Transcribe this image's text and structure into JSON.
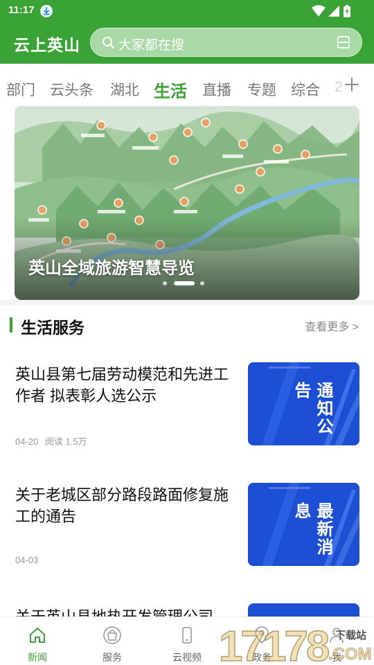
{
  "status_bar": {
    "time": "11:17"
  },
  "header": {
    "app_title": "云上英山",
    "search_placeholder": "大家都在搜"
  },
  "tabs": [
    {
      "label": "部门",
      "active": false
    },
    {
      "label": "云头条",
      "active": false
    },
    {
      "label": "湖北",
      "active": false
    },
    {
      "label": "生活",
      "active": true
    },
    {
      "label": "直播",
      "active": false
    },
    {
      "label": "专题",
      "active": false
    },
    {
      "label": "综合",
      "active": false
    },
    {
      "label": "2",
      "active": false
    }
  ],
  "banner": {
    "caption": "英山全域旅游智慧导览",
    "slide_count": 3,
    "active_slide": 2
  },
  "section": {
    "title": "生活服务",
    "more_label": "查看更多 >"
  },
  "news": [
    {
      "title": "英山县第七届劳动模范和先进工作者 拟表彰人选公示",
      "date": "04-20",
      "reads": "阅读 1.5万",
      "thumb_text": "通知公告"
    },
    {
      "title": "关于老城区部分路段路面修复施工的通告",
      "date": "04-03",
      "reads": "",
      "thumb_text": "最新消息"
    },
    {
      "title": "关于英山县地热开发管理公司",
      "date": "",
      "reads": "",
      "thumb_text": ""
    }
  ],
  "bottom_nav": [
    {
      "label": "新闻",
      "icon": "home-icon",
      "active": true
    },
    {
      "label": "服务",
      "icon": "bag-icon",
      "active": false
    },
    {
      "label": "云视频",
      "icon": "phone-icon",
      "active": false
    },
    {
      "label": "政务",
      "icon": "location-icon",
      "active": false
    },
    {
      "label": "我",
      "icon": "user-icon",
      "active": false
    }
  ],
  "watermark": {
    "text": "17178",
    "sub": "下载站",
    "domain": ".COM"
  },
  "colors": {
    "accent": "#3aa335",
    "thumb_blue": "#1c4fd4"
  }
}
